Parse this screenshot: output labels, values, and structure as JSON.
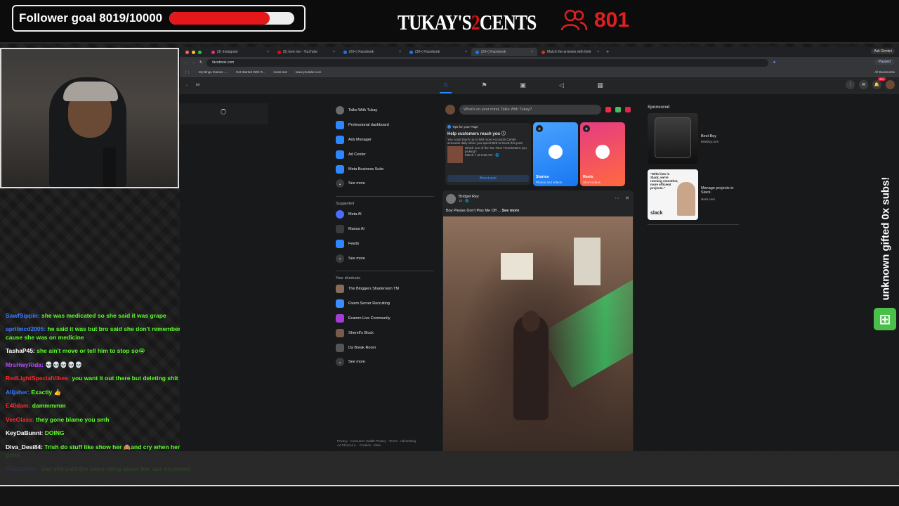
{
  "overlay": {
    "follower_goal": "Follower goal 8019/10000",
    "follower_progress": 0.8019,
    "brand_part1": "TUKAY'S",
    "brand_part2": "2",
    "brand_part3": "CENTS",
    "viewer_count": "801",
    "vertical_banner": "unknown gifted 0x subs!",
    "accent_red": "#e4181b",
    "chat_green": "#5dff2a"
  },
  "chat": [
    {
      "user": "SawfSippin:",
      "text": " she was medicated so she said it was grape",
      "color": "#3b7cff"
    },
    {
      "user": "aprilmcd2005:",
      "text": " he said it was but bro said she don't remember that cause she was on medicine",
      "color": "#3b7cff"
    },
    {
      "user": "TashaP45:",
      "text": " she ain't move or tell him to stop so😭",
      "color": "#ffffff"
    },
    {
      "user": "MrsHwyRida:",
      "text": " 💀💀💀💀💀",
      "color": "#b34cff"
    },
    {
      "user": "RedLightSpecialVibes:",
      "text": " you want it out there but deleting shit",
      "color": "#ff2a2a"
    },
    {
      "user": "Alijaher:",
      "text": " Exactly 👍",
      "color": "#3b7cff"
    },
    {
      "user": "E40dam:",
      "text": " dammmmm",
      "color": "#ff2a2a"
    },
    {
      "user": "VeeGlass:",
      "text": " they gone blame you smh",
      "color": "#ff2a2a"
    },
    {
      "user": "KeyDaBunni:",
      "text": " DOING",
      "color": "#ffffff"
    },
    {
      "user": "Diva_Desi84:",
      "text": " Trish do stuff like show her 🙈and cry when her page is gone",
      "color": "#ffffff"
    },
    {
      "user": "StaciCarter:",
      "text": " and she said the same thing about her last boyfriend",
      "color": "#3b7cff"
    }
  ],
  "browser": {
    "tabs": [
      {
        "label": "(3) Instagram",
        "color": "#e1306c"
      },
      {
        "label": "(5) love me - YouTube",
        "color": "#ff0000"
      },
      {
        "label": "(20+) Facebook",
        "color": "#1877f2"
      },
      {
        "label": "(30+) Facebook",
        "color": "#1877f2"
      },
      {
        "label": "(20+) Facebook",
        "color": "#1877f2"
      },
      {
        "label": "Match the arrestes with their",
        "color": "#d93025"
      }
    ],
    "gemini": "Ask Gemini",
    "url": "facebook.com",
    "paused": "Paused",
    "bookmarks": [
      "My Bingo Games -...",
      "Get Started With R...",
      "mass text",
      "www.youtube.com"
    ],
    "all_bookmarks": "All Bookmarks"
  },
  "fb": {
    "search_text": "bri",
    "notification_badge": "20+",
    "left_items": [
      {
        "label": "Talks With Tukay",
        "icon": "profile-avatar",
        "color": "#6b6b6b"
      },
      {
        "label": "Professional dashboard",
        "icon": "dashboard-icon",
        "color": "#2d88ff"
      },
      {
        "label": "Ads Manager",
        "icon": "ads-manager-icon",
        "color": "#2d88ff"
      },
      {
        "label": "Ad Center",
        "icon": "megaphone-icon",
        "color": "#2d88ff"
      },
      {
        "label": "Meta Business Suite",
        "icon": "business-suite-icon",
        "color": "#2d88ff"
      },
      {
        "label": "See more",
        "icon": "chevron-down-icon",
        "color": "#3a3b3c"
      }
    ],
    "suggested_label": "Suggested",
    "suggested_items": [
      {
        "label": "Meta AI",
        "icon": "meta-ai-icon",
        "color": "#4b6cff"
      },
      {
        "label": "Manus AI",
        "icon": "manus-ai-icon",
        "color": "#3a3b3c"
      },
      {
        "label": "Feeds",
        "icon": "feeds-icon",
        "color": "#2d88ff"
      },
      {
        "label": "See more",
        "icon": "chevron-down-icon",
        "color": "#3a3b3c"
      }
    ],
    "shortcuts_label": "Your shortcuts",
    "shortcut_items": [
      {
        "label": "The Bloggers Shaderoom TM",
        "icon": "group-thumb",
        "color": "#8a6a5a"
      },
      {
        "label": "Fivem Server Recruiting",
        "icon": "group-thumb",
        "color": "#3a8cff"
      },
      {
        "label": "Ecamm Live Community",
        "icon": "group-thumb",
        "color": "#a63cd6"
      },
      {
        "label": "Sherell's Block",
        "icon": "group-thumb",
        "color": "#7a5a4a"
      },
      {
        "label": "Da Break Room",
        "icon": "group-thumb",
        "color": "#555555"
      },
      {
        "label": "See more",
        "icon": "chevron-down-icon",
        "color": "#3a3b3c"
      }
    ],
    "footer": "Privacy · Consumer Health Privacy · Terms · Advertising · Ad Choices ▷ · Cookies · More",
    "composer_placeholder": "What's on your mind, Talks With Tukay?",
    "tips": {
      "header": "Tips for your Page",
      "title": "Help customers reach you ⓘ",
      "body": "You could reach up to 949 more Accounts Center accounts daily when you spend $29 to boost this post.",
      "question": "Which one of the Tax Time Trendsetters you picking?",
      "date": "March 7 at 9:30 AM · 🌐",
      "button": "Boost post"
    },
    "stories": {
      "label": "Stories",
      "sub": "Photos and videos"
    },
    "reels": {
      "label": "Reels",
      "sub": "Short videos"
    },
    "post": {
      "author": "Bridget Rey",
      "time": "1h · 🌐",
      "text": "Boy Please Don't Piss Me Off ... ",
      "see_more": "See more"
    },
    "sponsored": "Sponsored",
    "ads": [
      {
        "name": "Best Buy",
        "url": "bestbuy.com"
      },
      {
        "name": "Manage projects in Slack.",
        "url": "slack.com",
        "card_text": "\"With lists in Slack, we're running smoother, more efficient projects.\"",
        "logo": "slack"
      }
    ]
  }
}
